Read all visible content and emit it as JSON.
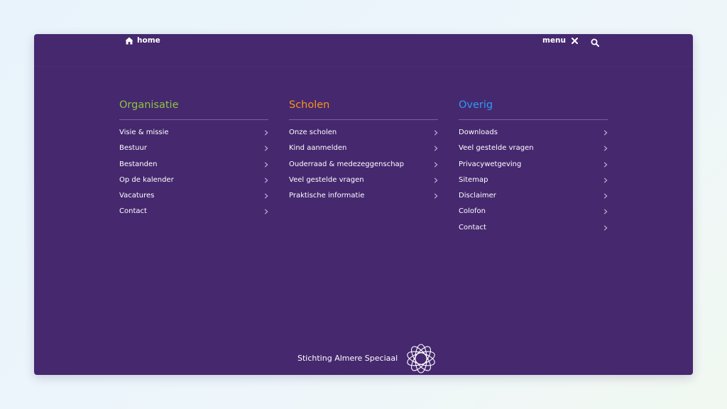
{
  "header": {
    "home_label": "home",
    "menu_label": "menu"
  },
  "columns": [
    {
      "title": "Organisatie",
      "color": "#8cc63f",
      "items": [
        "Visie & missie",
        "Bestuur",
        "Bestanden",
        "Op de kalender",
        "Vacatures",
        "Contact"
      ]
    },
    {
      "title": "Scholen",
      "color": "#f7941d",
      "items": [
        "Onze scholen",
        "Kind aanmelden",
        "Ouderraad & medezeggenschap",
        "Veel gestelde vragen",
        "Praktische informatie"
      ]
    },
    {
      "title": "Overig",
      "color": "#2e9bf0",
      "items": [
        "Downloads",
        "Veel gestelde vragen",
        "Privacywetgeving",
        "Sitemap",
        "Disclaimer",
        "Colofon",
        "Contact"
      ]
    }
  ],
  "footer": {
    "org_name": "Stichting Almere Speciaal",
    "logo_icon": "star-orbit-logo"
  },
  "colors": {
    "panel_bg": "#46286f",
    "page_bg": "#eaf4fb"
  }
}
